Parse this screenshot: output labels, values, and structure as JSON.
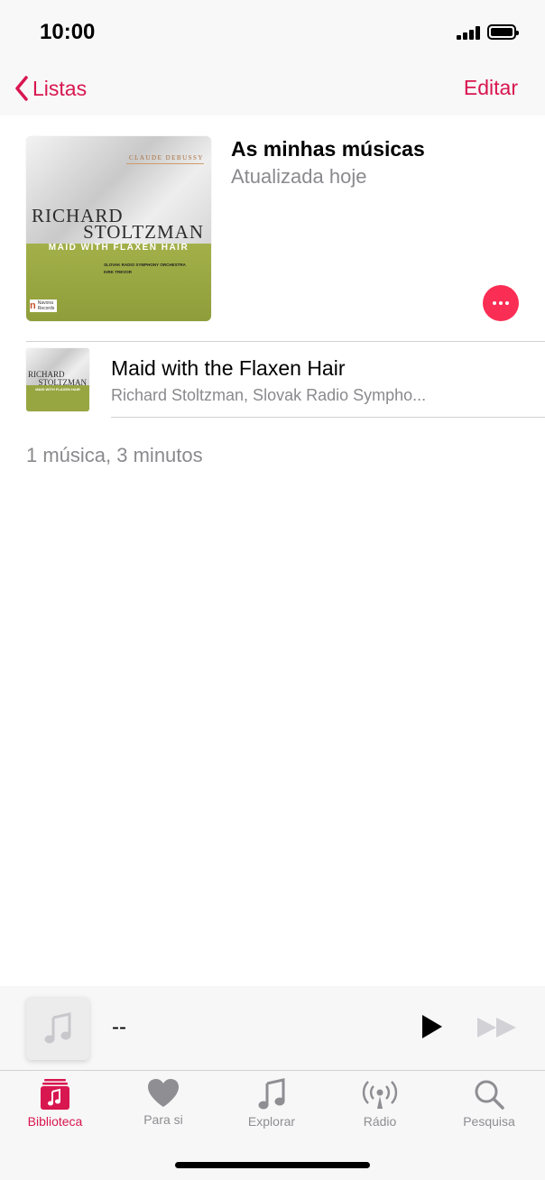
{
  "status_bar": {
    "time": "10:00"
  },
  "nav": {
    "back_label": "Listas",
    "edit_label": "Editar"
  },
  "playlist": {
    "title": "As minhas músicas",
    "subtitle": "Atualizada hoje",
    "summary": "1 música, 3 minutos"
  },
  "album_art": {
    "composer": "CLAUDE DEBUSSY",
    "artist_line1": "RICHARD",
    "artist_line2": "STOLTZMAN",
    "album_title": "MAID WITH FLAXEN HAIR",
    "orchestra": "SLOVAK RADIO SYMPHONY ORCHESTRA",
    "conductor": "KIRK TREVOR",
    "label": "Navona Records"
  },
  "songs": [
    {
      "title": "Maid with the Flaxen Hair",
      "artist": "Richard Stoltzman, Slovak Radio Sympho..."
    }
  ],
  "mini_player": {
    "title": "--"
  },
  "tabs": [
    {
      "label": "Biblioteca",
      "icon": "library-icon",
      "active": true
    },
    {
      "label": "Para si",
      "icon": "heart-icon",
      "active": false
    },
    {
      "label": "Explorar",
      "icon": "music-note-icon",
      "active": false
    },
    {
      "label": "Rádio",
      "icon": "radio-icon",
      "active": false
    },
    {
      "label": "Pesquisa",
      "icon": "search-icon",
      "active": false
    }
  ],
  "colors": {
    "accent": "#d8164f",
    "more_button": "#fa2d55",
    "secondary_text": "#8a8a8e",
    "album_green": "#98a642"
  }
}
